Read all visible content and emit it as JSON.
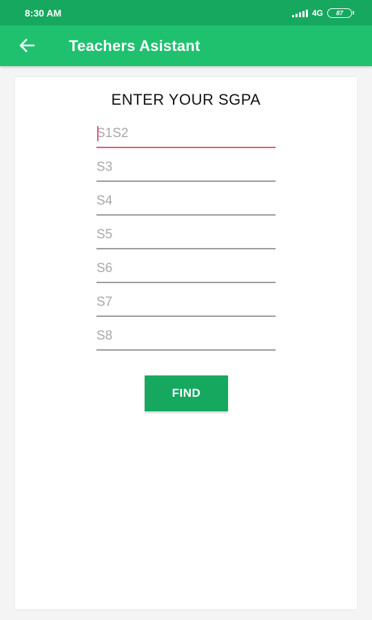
{
  "status_bar": {
    "time": "8:30 AM",
    "network": "4G",
    "battery": "87"
  },
  "app_bar": {
    "title": "Teachers Asistant",
    "back_icon": "arrow-left-icon"
  },
  "form": {
    "heading": "ENTER YOUR SGPA",
    "fields": [
      {
        "placeholder": "S1S2",
        "value": ""
      },
      {
        "placeholder": "S3",
        "value": ""
      },
      {
        "placeholder": "S4",
        "value": ""
      },
      {
        "placeholder": "S5",
        "value": ""
      },
      {
        "placeholder": "S6",
        "value": ""
      },
      {
        "placeholder": "S7",
        "value": ""
      },
      {
        "placeholder": "S8",
        "value": ""
      }
    ],
    "find_label": "FIND"
  },
  "colors": {
    "status_bar": "#17a85f",
    "app_bar": "#1fc16f",
    "accent": "#e0587f",
    "button": "#17a85f"
  }
}
